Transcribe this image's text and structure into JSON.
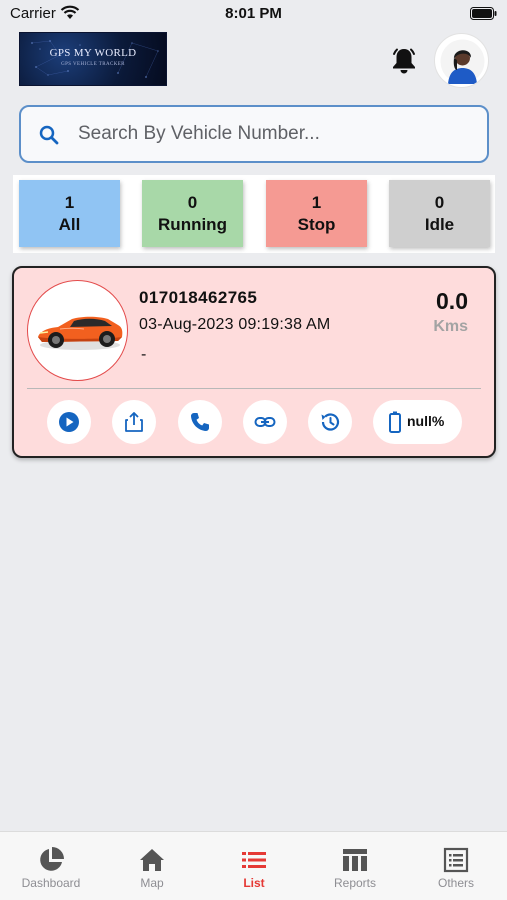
{
  "status_bar": {
    "carrier": "Carrier",
    "time": "8:01 PM"
  },
  "header": {
    "logo_title": "GPS MY WORLD",
    "logo_subtitle": "GPS VEHICLE TRACKER",
    "bell_icon": "bell-icon",
    "avatar_icon": "user-avatar"
  },
  "search": {
    "placeholder": "Search By Vehicle Number...",
    "value": "",
    "icon": "search-icon"
  },
  "filters": [
    {
      "count": "1",
      "label": "All",
      "color": "#90c4f3"
    },
    {
      "count": "0",
      "label": "Running",
      "color": "#a8d8a8"
    },
    {
      "count": "1",
      "label": "Stop",
      "color": "#f59a93"
    },
    {
      "count": "0",
      "label": "Idle",
      "color": "#cfcfcf"
    }
  ],
  "vehicle": {
    "number": "017018462765",
    "datetime": "03-Aug-2023 09:19:38 AM",
    "address": "-",
    "distance_value": "0.0",
    "distance_unit": "Kms",
    "battery": "null%",
    "card_color": "#fedcdc",
    "actions": [
      "play-icon",
      "share-icon",
      "phone-icon",
      "link-icon",
      "history-icon"
    ]
  },
  "tabs": [
    {
      "label": "Dashboard",
      "icon": "pie-chart-icon",
      "active": false
    },
    {
      "label": "Map",
      "icon": "home-icon",
      "active": false
    },
    {
      "label": "List",
      "icon": "list-icon",
      "active": true
    },
    {
      "label": "Reports",
      "icon": "table-icon",
      "active": false
    },
    {
      "label": "Others",
      "icon": "document-list-icon",
      "active": false
    }
  ],
  "colors": {
    "accent_red": "#e53935",
    "icon_blue": "#1565c0",
    "search_border": "#5c8fc9"
  }
}
